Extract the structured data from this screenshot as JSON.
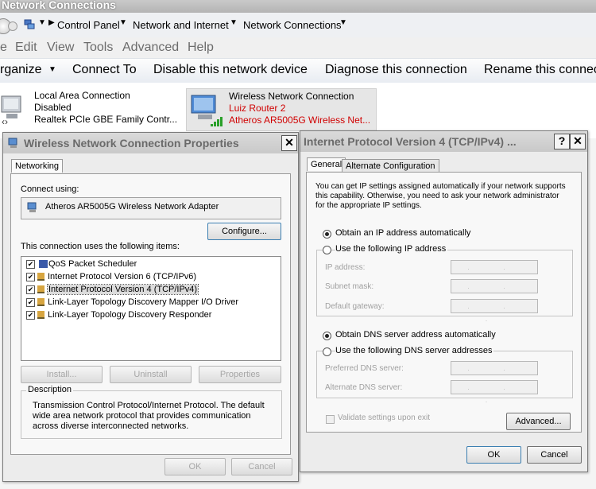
{
  "window": {
    "title": "Network Connections"
  },
  "address_bar": {
    "crumbs": [
      "Control Panel",
      "Network and Internet",
      "Network Connections"
    ]
  },
  "menu": {
    "items": [
      "e",
      "Edit",
      "View",
      "Tools",
      "Advanced",
      "Help"
    ]
  },
  "commands": {
    "organize": "rganize",
    "connect_to": "Connect To",
    "disable": "Disable this network device",
    "diagnose": "Diagnose this connection",
    "rename": "Rename this connec"
  },
  "connections": {
    "lan": {
      "name": "Local Area Connection",
      "status": "Disabled",
      "device": "Realtek PCIe GBE Family Contr..."
    },
    "wireless": {
      "name": "Wireless Network Connection",
      "network": "Luiz Router  2",
      "device": "Atheros AR5005G Wireless Net..."
    }
  },
  "props_dialog": {
    "title": "Wireless Network Connection Properties",
    "tab": "Networking",
    "connect_using_label": "Connect using:",
    "adapter": "Atheros AR5005G Wireless Network Adapter",
    "configure": "Configure...",
    "items_label": "This connection uses the following items:",
    "items": [
      {
        "label": "QoS Packet Scheduler",
        "checked": true
      },
      {
        "label": "Internet Protocol Version 6 (TCP/IPv6)",
        "checked": true
      },
      {
        "label": "Internet Protocol Version 4 (TCP/IPv4)",
        "checked": true
      },
      {
        "label": "Link-Layer Topology Discovery Mapper I/O Driver",
        "checked": true
      },
      {
        "label": "Link-Layer Topology Discovery Responder",
        "checked": true
      }
    ],
    "install": "Install...",
    "uninstall": "Uninstall",
    "properties": "Properties",
    "description_label": "Description",
    "description": "Transmission Control Protocol/Internet Protocol. The default wide area network protocol that provides communication across diverse interconnected networks.",
    "ok": "OK",
    "cancel": "Cancel"
  },
  "ipv4_dialog": {
    "title": "Internet Protocol Version 4 (TCP/IPv4) ...",
    "help": "?",
    "tab_general": "General",
    "tab_alternate": "Alternate Configuration",
    "intro": "You can get IP settings assigned automatically if your network supports this capability. Otherwise, you need to ask your network administrator for the appropriate IP settings.",
    "obtain_ip": "Obtain an IP address automatically",
    "use_ip": "Use the following IP address",
    "ip_address": "IP address:",
    "subnet_mask": "Subnet mask:",
    "default_gateway": "Default gateway:",
    "obtain_dns": "Obtain DNS server address automatically",
    "use_dns": "Use the following DNS server addresses",
    "preferred_dns": "Preferred DNS server:",
    "alternate_dns": "Alternate DNS server:",
    "ip_placeholder": ". . .",
    "validate": "Validate settings upon exit",
    "advanced": "Advanced...",
    "ok": "OK",
    "cancel": "Cancel"
  }
}
